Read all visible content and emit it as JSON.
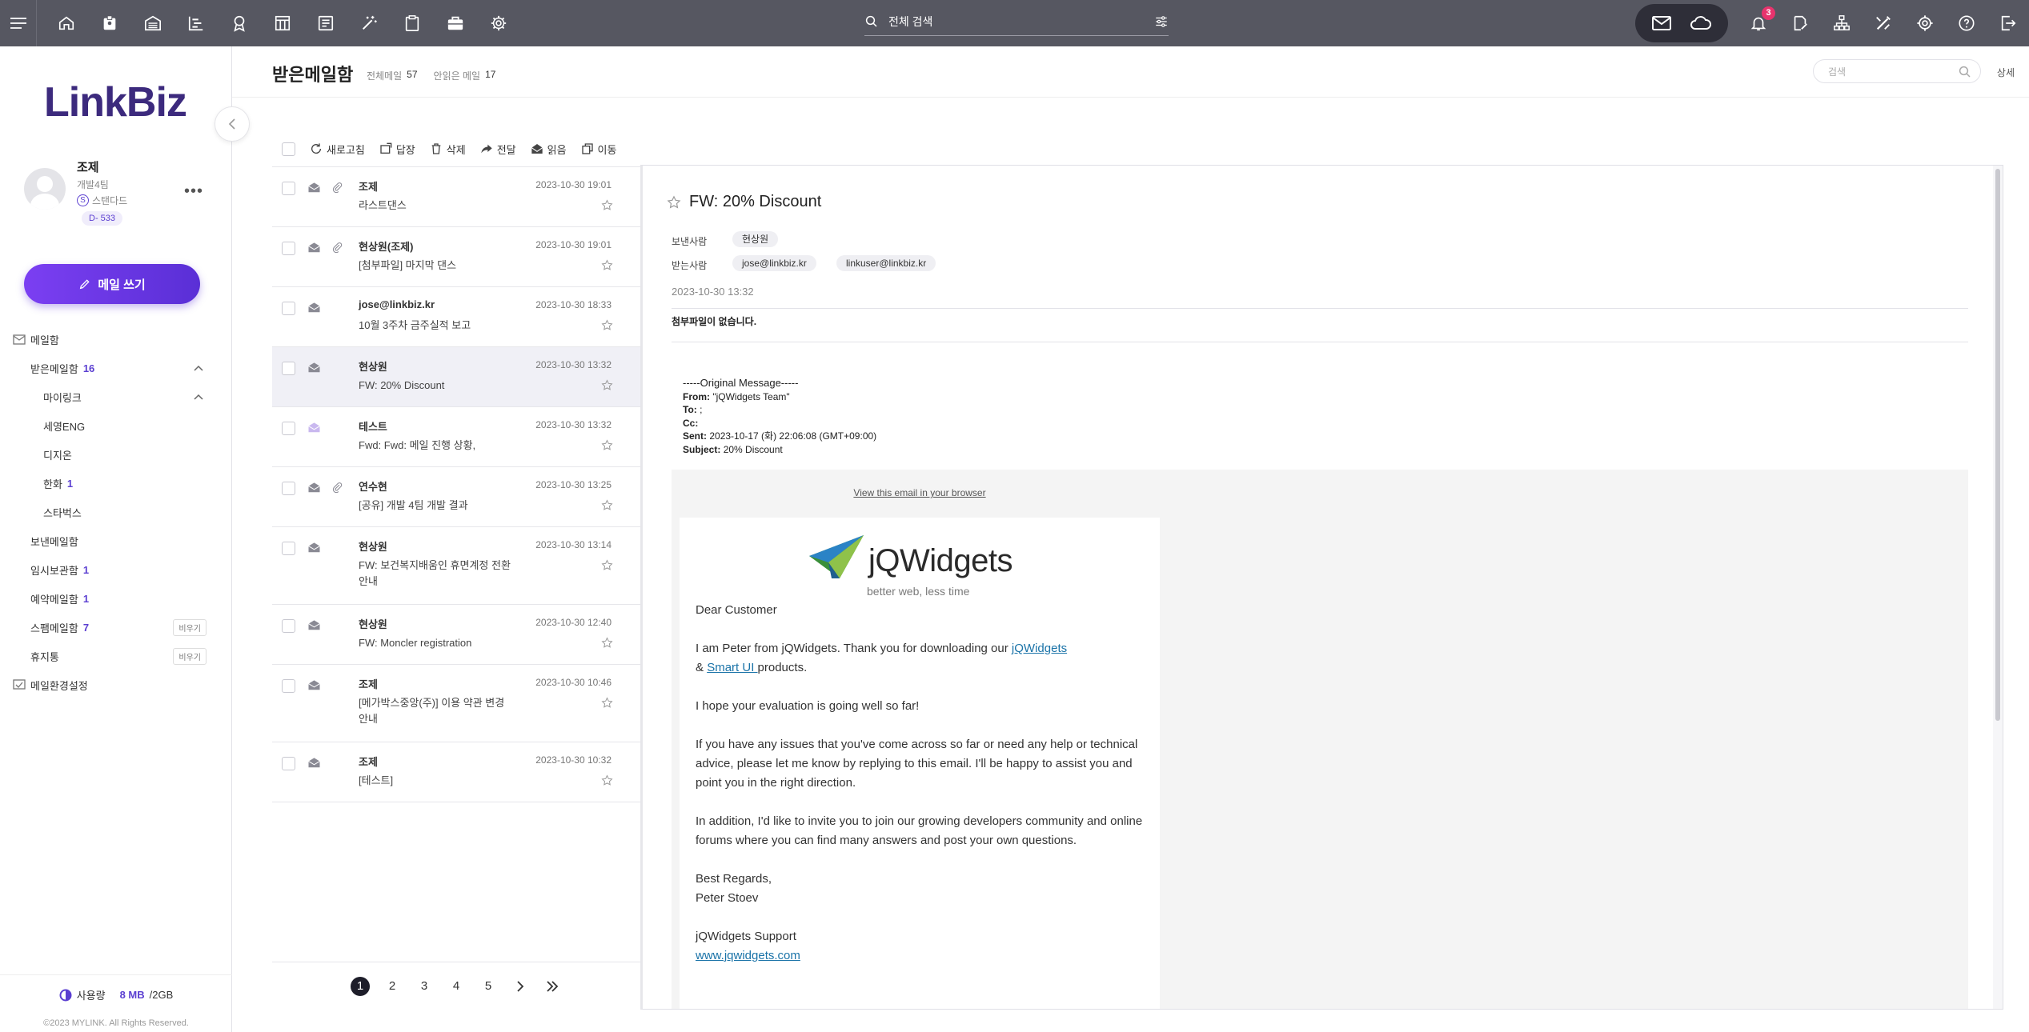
{
  "topbar": {
    "search_placeholder": "전체 검색",
    "notification_count": "3"
  },
  "sidebar": {
    "logo": "LinkBiz",
    "profile": {
      "name": "조제",
      "team": "개발4팀",
      "plan_badge": "S",
      "plan": "스탠다드",
      "dday": "D- 533"
    },
    "compose_label": "메일 쓰기",
    "mailbox_header": "메일함",
    "items": [
      {
        "label": "받은메일함",
        "count": "16",
        "level": 1,
        "chevron": true
      },
      {
        "label": "마이링크",
        "count": "",
        "level": 2,
        "chevron": true
      },
      {
        "label": "세영ENG",
        "count": "",
        "level": 2
      },
      {
        "label": "디지온",
        "count": "",
        "level": 2
      },
      {
        "label": "한화",
        "count": "1",
        "level": 2
      },
      {
        "label": "스타벅스",
        "count": "",
        "level": 2
      },
      {
        "label": "보낸메일함",
        "count": "",
        "level": 1
      },
      {
        "label": "임시보관함",
        "count": "1",
        "level": 1
      },
      {
        "label": "예약메일함",
        "count": "1",
        "level": 1
      },
      {
        "label": "스팸메일함",
        "count": "7",
        "level": 1,
        "empty": "비우기"
      },
      {
        "label": "휴지통",
        "count": "",
        "level": 1,
        "empty": "비우기"
      }
    ],
    "settings_label": "메일환경설정",
    "storage": {
      "label": "사용량",
      "used": "8 MB",
      "total": "/2GB"
    },
    "copyright": "©2023 MYLINK. All Rights Reserved."
  },
  "header": {
    "title": "받은메일함",
    "total_label": "전체메일",
    "total": "57",
    "unread_label": "안읽은 메일",
    "unread": "17",
    "search_placeholder": "검색",
    "detail_label": "상세"
  },
  "toolbar": {
    "refresh": "새로고침",
    "reply": "답장",
    "delete": "삭제",
    "forward": "전달",
    "read": "읽음",
    "move": "이동"
  },
  "mails": [
    {
      "from": "조제",
      "subject": "라스트댄스",
      "date": "2023-10-30 19:01",
      "attach": true,
      "h": 75
    },
    {
      "from": "현상원(조제)",
      "subject": "[첨부파일] 마지막 댄스",
      "date": "2023-10-30 19:01",
      "attach": true,
      "h": 75
    },
    {
      "from": "jose@linkbiz.kr",
      "subject": "10월 3주차 금주실적 보고",
      "date": "2023-10-30 18:33",
      "attach": false,
      "h": 75
    },
    {
      "from": "현상원",
      "subject": "FW: 20% Discount",
      "date": "2023-10-30 13:32",
      "attach": false,
      "h": 75,
      "selected": true
    },
    {
      "from": "테스트",
      "subject": "Fwd: Fwd: 메일 진행 상황,",
      "date": "2023-10-30 13:32",
      "attach": false,
      "h": 75,
      "unread_icon": true
    },
    {
      "from": "연수현",
      "subject": "[공유] 개발 4팀 개발 결과",
      "date": "2023-10-30 13:25",
      "attach": true,
      "h": 75
    },
    {
      "from": "현상원",
      "subject": "FW: 보건복지배움인 휴면계정 전환 안내",
      "date": "2023-10-30 13:14",
      "attach": false,
      "h": 97
    },
    {
      "from": "현상원",
      "subject": "FW: Moncler registration",
      "date": "2023-10-30 12:40",
      "attach": false,
      "h": 75
    },
    {
      "from": "조제",
      "subject": "[메가박스중앙(주)] 이용 약관 변경 안내",
      "date": "2023-10-30 10:46",
      "attach": false,
      "h": 97
    },
    {
      "from": "조제",
      "subject": "[테스트]",
      "date": "2023-10-30 10:32",
      "attach": false,
      "h": 75
    }
  ],
  "pager": {
    "pages": [
      "1",
      "2",
      "3",
      "4",
      "5"
    ],
    "current": "1"
  },
  "reader": {
    "subject": "FW: 20% Discount",
    "sender_label": "보낸사람",
    "sender": "현상원",
    "recipient_label": "받는사람",
    "recipients": [
      "jose@linkbiz.kr",
      "linkuser@linkbiz.kr"
    ],
    "date": "2023-10-30 13:32",
    "no_attachment": "첨부파일이 없습니다.",
    "original": {
      "header": "-----Original Message-----",
      "from_label": "From:",
      "from": "\"jQWidgets Team\"",
      "to_label": "To:",
      "to": ";",
      "cc_label": "Cc:",
      "cc": "",
      "sent_label": "Sent:",
      "sent": "2023-10-17 (화) 22:06:08 (GMT+09:00)",
      "subject_label": "Subject:",
      "subject": "20% Discount"
    },
    "view_browser": "View this email in your browser",
    "brand": "jQWidgets",
    "tagline": "better web, less time",
    "greeting": "Dear Customer",
    "p1_a": "I am Peter from jQWidgets. Thank you for downloading our ",
    "p1_link1": "jQWidgets",
    "p1_b": "& ",
    "p1_link2": "Smart UI ",
    "p1_c": "products.",
    "p2": "I hope your evaluation is going well so far!",
    "p3": "If you have any issues that you've come across so far or need any help or technical advice, please let me know by replying to this email. I'll be happy to assist you and point you in the right direction.",
    "p4": "In addition, I'd like to invite you to join our growing developers community and online forums where you can find many answers and post your own questions.",
    "sign1": "Best Regards,",
    "sign2": "Peter Stoev",
    "sign3": "jQWidgets Support",
    "site": "www.jqwidgets.com"
  },
  "colors": {
    "accent": "#5b3fd1",
    "topbar": "#565761",
    "badge": "#e8336d"
  }
}
